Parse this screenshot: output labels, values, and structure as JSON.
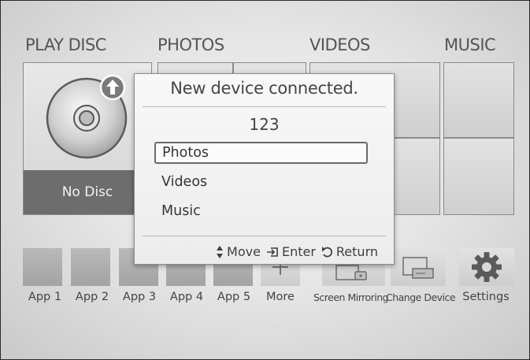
{
  "sections": {
    "play_disc": "PLAY DISC",
    "photos": "PHOTOS",
    "videos": "VIDEOS",
    "music": "MUSIC"
  },
  "disc": {
    "status": "No Disc",
    "eject_icon": "up-arrow-icon"
  },
  "apps": [
    {
      "label": "App 1"
    },
    {
      "label": "App 2"
    },
    {
      "label": "App 3"
    },
    {
      "label": "App 4"
    },
    {
      "label": "App 5"
    },
    {
      "label": "More",
      "icon": "plus-icon"
    },
    {
      "label": "Screen Mirroring",
      "icon": "screen-mirroring-icon"
    },
    {
      "label": "Change Device",
      "icon": "change-device-icon"
    },
    {
      "label": "Settings",
      "icon": "gear-icon"
    }
  ],
  "dialog": {
    "title": "New device connected.",
    "device_name": "123",
    "options": [
      "Photos",
      "Videos",
      "Music"
    ],
    "selected_index": 0,
    "footer": {
      "move": "Move",
      "enter": "Enter",
      "return": "Return"
    }
  },
  "colors": {
    "selected_border": "#6a6a6a",
    "disc_status_bg": "#6d6d6d"
  }
}
